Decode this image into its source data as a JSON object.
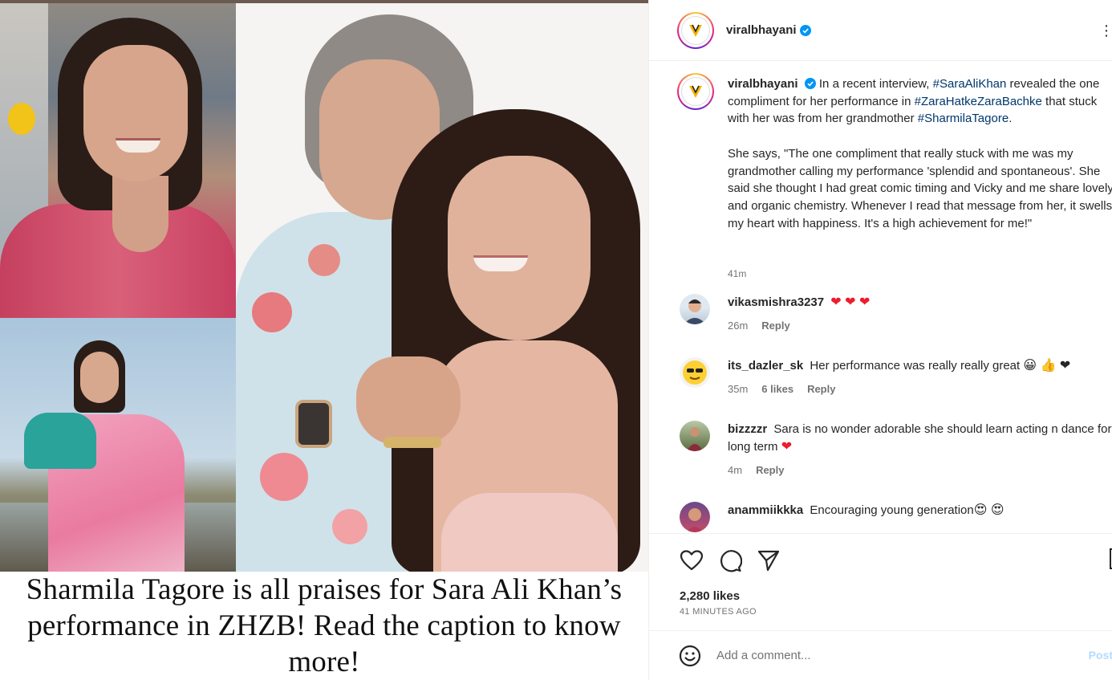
{
  "post": {
    "image_caption": "Sharmila Tagore is all praises for Sara Ali Khan’s performance in ZHZB! Read the caption to know more!"
  },
  "header": {
    "username": "viralbhayani",
    "more_label": "⋮"
  },
  "caption": {
    "username": "viralbhayani",
    "text_1": "In a recent interview,",
    "tag_1": "#SaraAliKhan",
    "text_2": "revealed the one compliment for her performance in",
    "tag_2": "#ZaraHatkeZaraBachke",
    "text_3": "that stuck with her was from her grandmother",
    "tag_3": "#SharmilaTagore",
    "text_4": ".",
    "quote": "She says, \"The one compliment that really stuck with me was my grandmother calling my performance 'splendid and spontaneous'. She said she thought I had great comic timing and Vicky and me share lovely and organic chemistry. Whenever I read that message from her, it swells my heart with happiness. It's a high achievement for me!\"",
    "time": "41m"
  },
  "comments": [
    {
      "username": "vikasmishra3237",
      "text": "",
      "emoji": "❤ ❤ ❤",
      "time": "26m",
      "likes": "",
      "reply": "Reply"
    },
    {
      "username": "its_dazler_sk",
      "text": "Her performance was really really great",
      "emoji": "😀 👍 ❤",
      "time": "35m",
      "likes": "6 likes",
      "reply": "Reply"
    },
    {
      "username": "bizzzzr",
      "text": "Sara is no wonder adorable she should learn acting n dance for long term",
      "emoji": "❤",
      "time": "4m",
      "likes": "",
      "reply": "Reply"
    },
    {
      "username": "anammiikkka",
      "text": "Encouraging young generation",
      "emoji": "😍 😍",
      "time": "",
      "likes": "",
      "reply": ""
    }
  ],
  "actions": {
    "likes": "2,280 likes",
    "age": "41 MINUTES AGO"
  },
  "add_comment": {
    "placeholder": "Add a comment...",
    "post_label": "Post"
  },
  "colors": {
    "hashtag": "#00376b",
    "heart": "#ed1c2e",
    "verified": "#0095f6",
    "meta": "#737373"
  }
}
